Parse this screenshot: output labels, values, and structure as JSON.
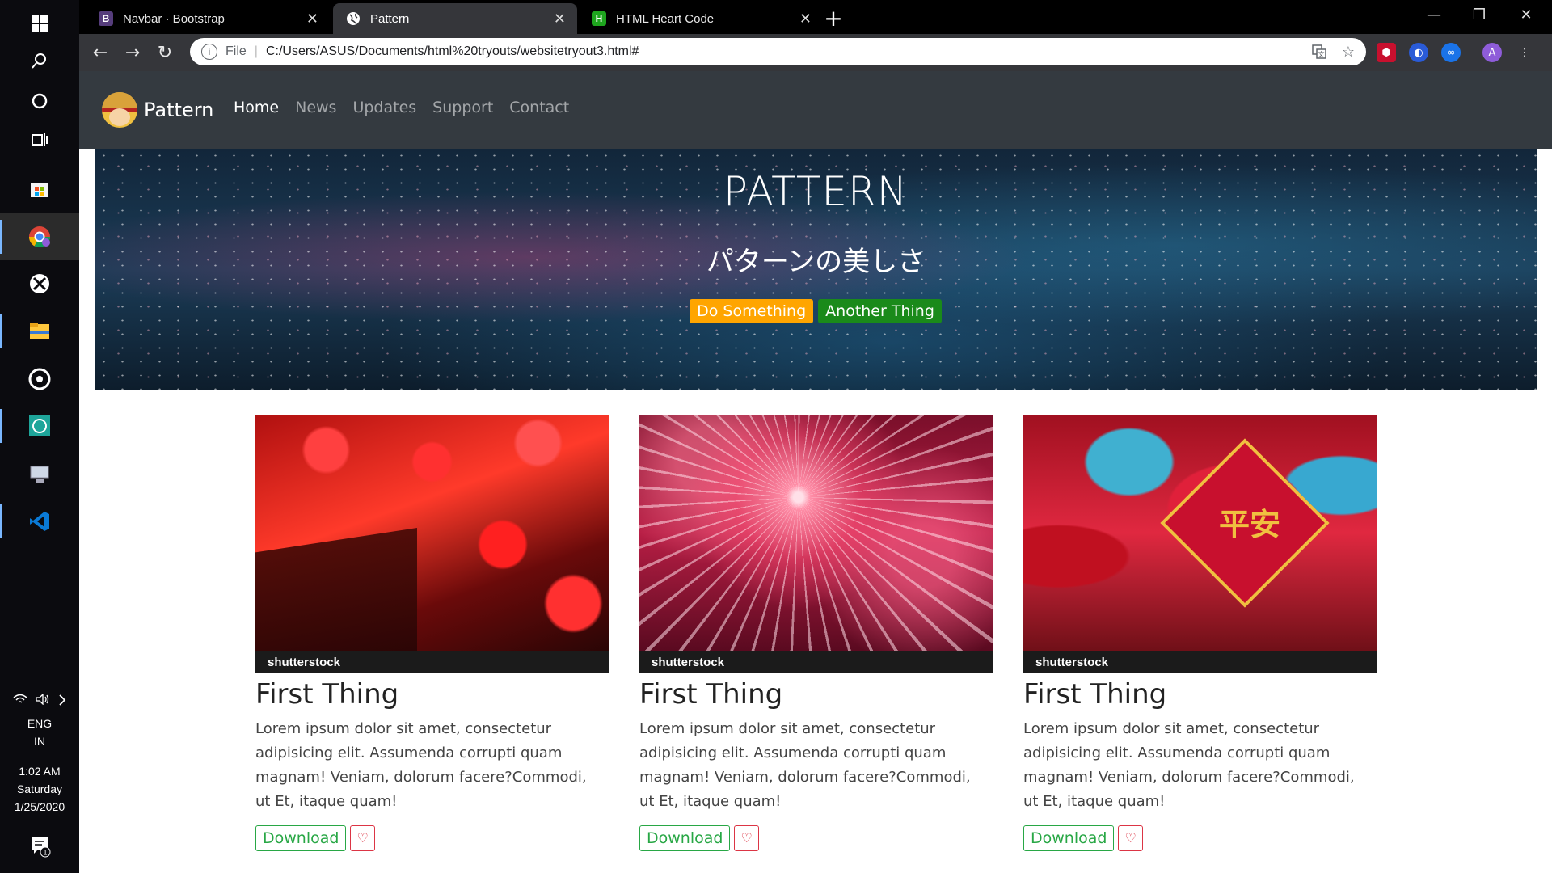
{
  "taskbar": {
    "language": "ENG",
    "region": "IN",
    "time": "1:02 AM",
    "day": "Saturday",
    "date": "1/25/2020",
    "notification_count": "1"
  },
  "browser": {
    "tabs": [
      {
        "title": "Navbar · Bootstrap",
        "favicon": "B",
        "favicon_color": "#563d7c"
      },
      {
        "title": "Pattern",
        "favicon": "globe",
        "favicon_color": "#ffffff"
      },
      {
        "title": "HTML Heart Code",
        "favicon": "H",
        "favicon_color": "#1ea51e"
      }
    ],
    "address": {
      "scheme_label": "File",
      "url": "C:/Users/ASUS/Documents/html%20tryouts/websitetryout3.html#"
    },
    "profile_initial": "A"
  },
  "site": {
    "brand": "Pattern",
    "nav": [
      "Home",
      "News",
      "Updates",
      "Support",
      "Contact"
    ],
    "hero": {
      "title": "PATTERN",
      "subtitle": "パターンの美しさ",
      "btn_primary": "Do Something",
      "btn_secondary": "Another Thing"
    },
    "cards": [
      {
        "title": "First Thing",
        "text": "Lorem ipsum dolor sit amet, consectetur adipisicing elit. Assumenda corrupti quam magnam! Veniam, dolorum facere?Commodi, ut Et, itaque quam!",
        "download": "Download",
        "watermark": "shutterstock"
      },
      {
        "title": "First Thing",
        "text": "Lorem ipsum dolor sit amet, consectetur adipisicing elit. Assumenda corrupti quam magnam! Veniam, dolorum facere?Commodi, ut Et, itaque quam!",
        "download": "Download",
        "watermark": "shutterstock"
      },
      {
        "title": "First Thing",
        "text": "Lorem ipsum dolor sit amet, consectetur adipisicing elit. Assumenda corrupti quam magnam! Veniam, dolorum facere?Commodi, ut Et, itaque quam!",
        "download": "Download",
        "watermark": "shutterstock",
        "image_text": "平安"
      }
    ]
  },
  "colors": {
    "navbar": "#343a40",
    "warning": "#ffa500",
    "success": "#28a745",
    "danger": "#dc3545"
  }
}
